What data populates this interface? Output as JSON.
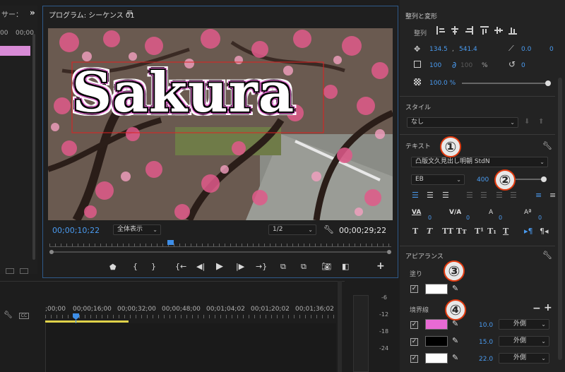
{
  "left_panel": {
    "title": "サー："
  },
  "program": {
    "title": "プログラム: シーケンス 01",
    "timecode_current": "00;00;10;22",
    "fit_label": "全体表示",
    "resolution": "1/2",
    "timecode_duration": "00;00;29;22",
    "title_text": "Sakura"
  },
  "timeline": {
    "ruler_labels": [
      ";00;00",
      "00;00;16;00",
      "00;00;32;00",
      "00;00;48;00",
      "00;01;04;02",
      "00;01;20;02",
      "00;01;36;02"
    ],
    "left_times": [
      "00",
      "00;00"
    ],
    "meter_labels": [
      "-6",
      "-12",
      "-18",
      "-24"
    ]
  },
  "properties": {
    "align_section": "整列と変形",
    "align_label": "整列",
    "position_x": "134.5",
    "position_y": "541.4",
    "position_sep": ",",
    "anchor_x": "0.0",
    "anchor_y": "0",
    "scale": "100",
    "scale_locked_value": "100",
    "scale_unit": "%",
    "rotation": "0",
    "opacity": "100.0 %",
    "style_section": "スタイル",
    "style_value": "なし",
    "text_section": "テキスト",
    "font_name": "凸版文久見出し明朝 StdN",
    "font_style": "EB",
    "font_size": "400",
    "appearance_section": "アピアランス",
    "fill_label": "塗り",
    "stroke_label": "境界線",
    "strokes": [
      {
        "color": "#e86ad4",
        "width": "10.0",
        "type": "外側"
      },
      {
        "color": "#000000",
        "width": "15.0",
        "type": "外側"
      },
      {
        "color": "#ffffff",
        "width": "22.0",
        "type": "外側"
      }
    ],
    "fill_color": "#ffffff"
  },
  "callouts": [
    "①",
    "②",
    "③",
    "④"
  ]
}
